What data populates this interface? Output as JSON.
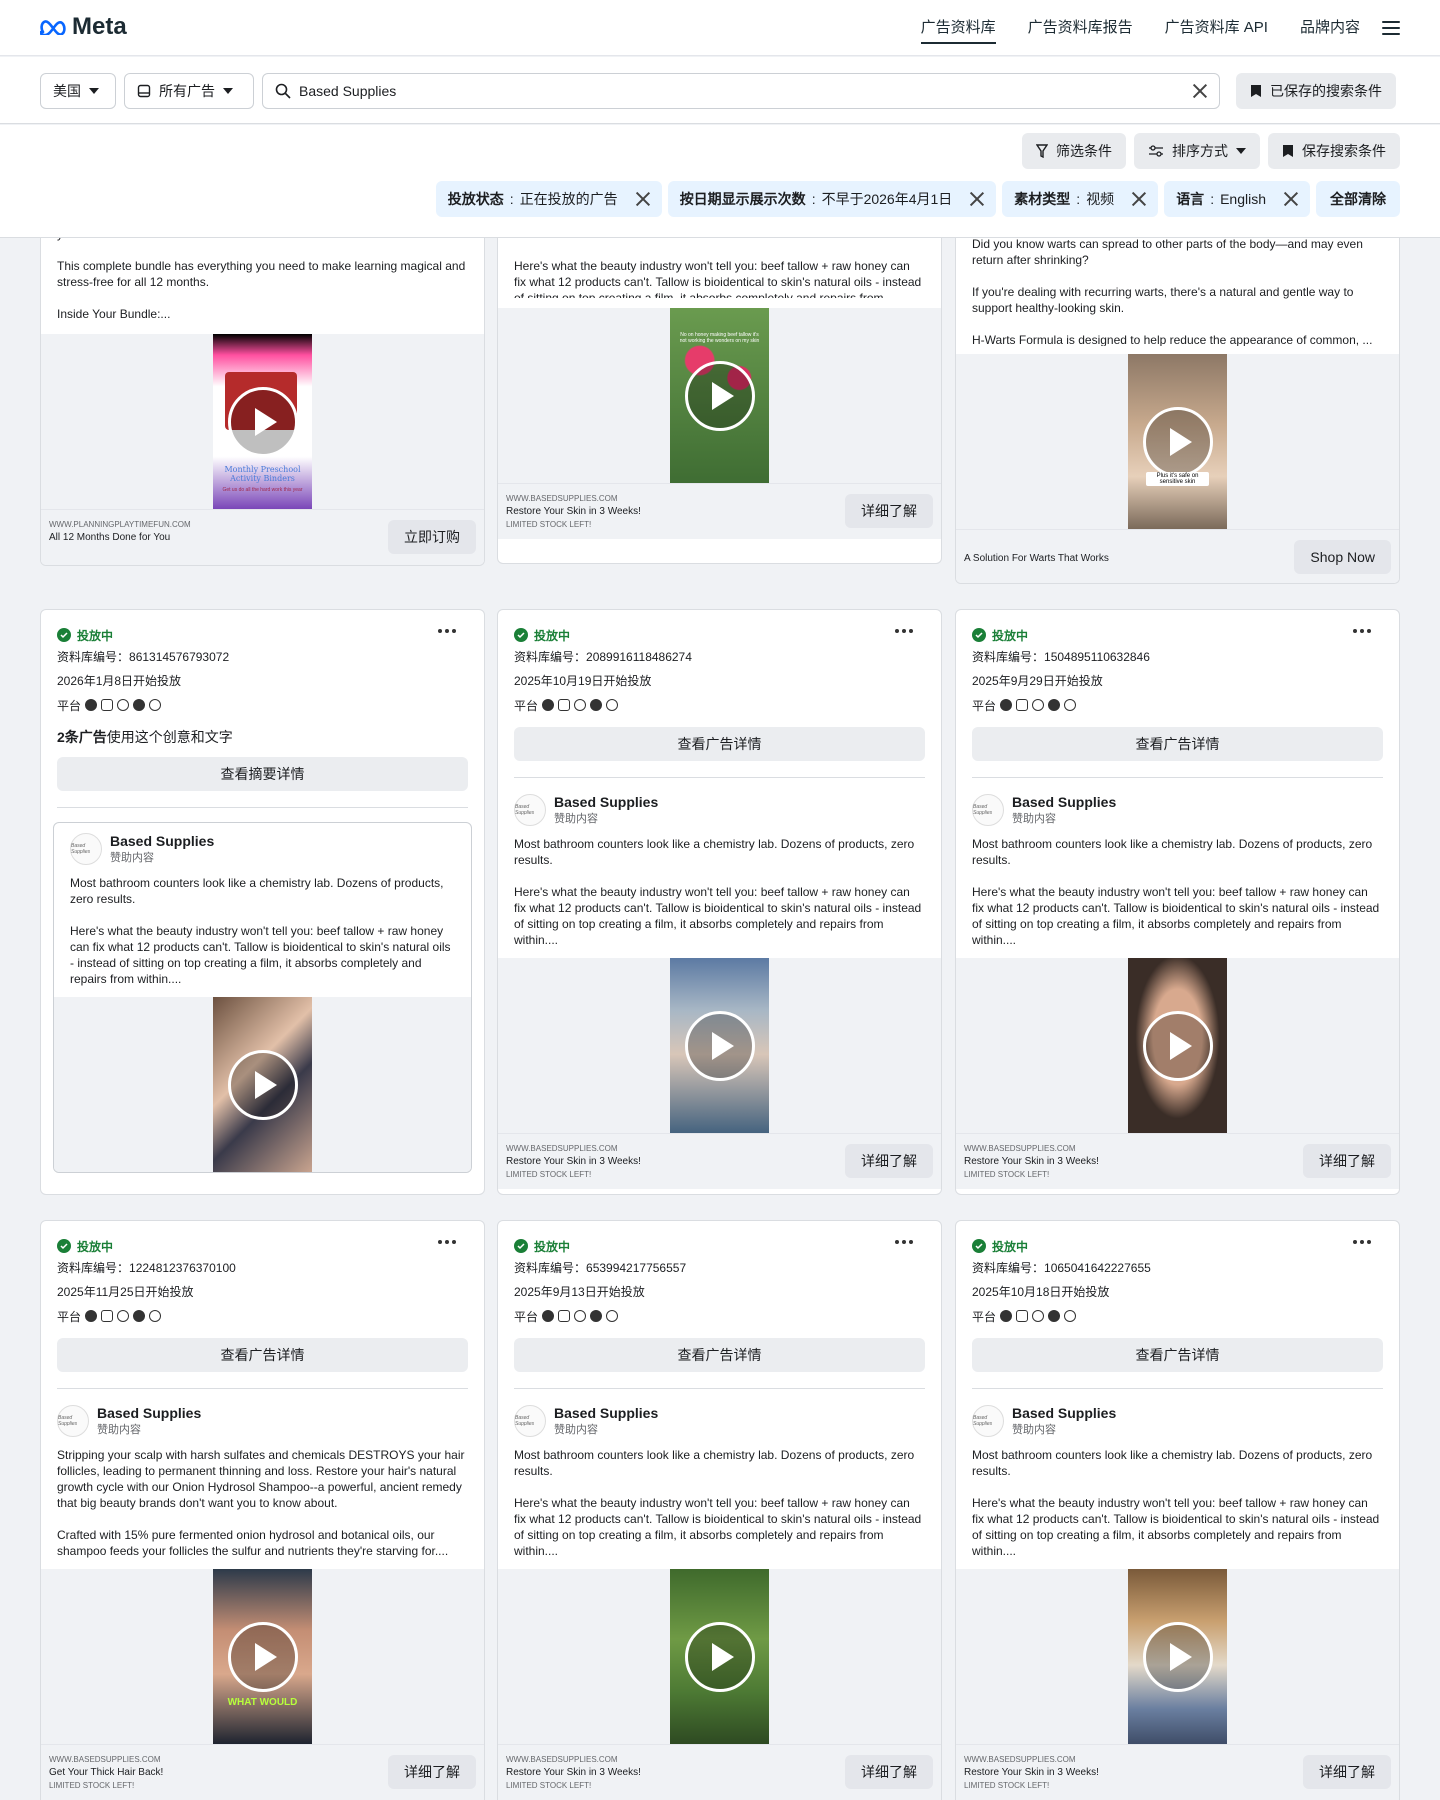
{
  "nav": {
    "logo": "Meta",
    "links": [
      "广告资料库",
      "广告资料库报告",
      "广告资料库 API",
      "品牌内容"
    ]
  },
  "search": {
    "country": "美国",
    "ad_type": "所有广告",
    "query": "Based Supplies",
    "saved_label": "已保存的搜索条件"
  },
  "tools": {
    "filter": "筛选条件",
    "sort": "排序方式",
    "save": "保存搜索条件"
  },
  "chips": [
    {
      "key": "投放状态",
      "value": "正在投放的广告"
    },
    {
      "key": "按日期显示展示次数",
      "value": "不早于2026年4月1日"
    },
    {
      "key": "素材类型",
      "value": "视频"
    },
    {
      "key": "语言",
      "value": "English"
    }
  ],
  "clear_all": "全部清除",
  "labels": {
    "status": "投放中",
    "lib": "资料库编号：",
    "platform": "平台",
    "details": "查看广告详情",
    "summary_details": "查看摘要详情",
    "sponsored": "赞助内容",
    "avatar": "Based Supplies",
    "summary_count": "2条广告",
    "summary_rest": "使用这个创意和文字"
  },
  "top_cards": [
    {
      "text": "year.\n\nThis complete bundle has everything you need to make learning magical and stress-free for all 12 months.\n\nInside Your Bundle:...",
      "site": "WWW.PLANNINGPLAYTIMEFUN.COM",
      "title": "All 12 Months Done for You",
      "desc": "",
      "cta": "立即订购",
      "overlay": "Monthly Preschool Activity Binders",
      "overlay2": "Get us do all the hard work this year"
    },
    {
      "text": "results.\n\nHere's what the beauty industry won't tell you: beef tallow + raw honey can fix what 12 products can't. Tallow is bioidentical to skin's natural oils - instead of sitting on top creating a film, it absorbs completely and repairs from within....",
      "site": "WWW.BASEDSUPPLIES.COM",
      "title": "Restore Your Skin in 3 Weeks!",
      "desc": "LIMITED STOCK LEFT!",
      "cta": "详细了解",
      "overlay": "No on honey making beef tallow it's not working the wonders on my skin",
      "overlay2": ""
    },
    {
      "text": "Did you know warts can spread to other parts of the body—and may even return after shrinking?\n\nIf you're dealing with recurring warts, there's a natural and gentle way to support healthy-looking skin.\n\nH-Warts Formula is designed to help reduce the appearance of common, ...",
      "site": "",
      "title": "A Solution For Warts That Works",
      "desc": "",
      "cta": "Shop Now",
      "overlay": "Plus it's safe on sensitive skin",
      "overlay2": ""
    }
  ],
  "cards": [
    {
      "id": "861314576793072",
      "date": "2026年1月8日开始投放",
      "advertiser": "Based Supplies",
      "text": "Most bathroom counters look like a chemistry lab. Dozens of products, zero results.\n\nHere's what the beauty industry won't tell you: beef tallow + raw honey can fix what 12 products can't. Tallow is bioidentical to skin's natural oils - instead of sitting on top creating a film, it absorbs completely and repairs from within....",
      "site": "",
      "title": "",
      "desc": "",
      "cta": "",
      "overlay": ""
    },
    {
      "id": "2089916118486274",
      "date": "2025年10月19日开始投放",
      "advertiser": "Based Supplies",
      "text": "Most bathroom counters look like a chemistry lab. Dozens of products, zero results.\n\nHere's what the beauty industry won't tell you: beef tallow + raw honey can fix what 12 products can't. Tallow is bioidentical to skin's natural oils - instead of sitting on top creating a film, it absorbs completely and repairs from within....",
      "site": "WWW.BASEDSUPPLIES.COM",
      "title": "Restore Your Skin in 3 Weeks!",
      "desc": "LIMITED STOCK LEFT!",
      "cta": "详细了解",
      "overlay": ""
    },
    {
      "id": "1504895110632846",
      "date": "2025年9月29日开始投放",
      "advertiser": "Based Supplies",
      "text": "Most bathroom counters look like a chemistry lab. Dozens of products, zero results.\n\nHere's what the beauty industry won't tell you: beef tallow + raw honey can fix what 12 products can't. Tallow is bioidentical to skin's natural oils - instead of sitting on top creating a film, it absorbs completely and repairs from within....",
      "site": "WWW.BASEDSUPPLIES.COM",
      "title": "Restore Your Skin in 3 Weeks!",
      "desc": "LIMITED STOCK LEFT!",
      "cta": "详细了解",
      "overlay": ""
    },
    {
      "id": "1224812376370100",
      "date": "2025年11月25日开始投放",
      "advertiser": "Based Supplies",
      "text": "Stripping your scalp with harsh sulfates and chemicals DESTROYS your hair follicles, leading to permanent thinning and loss. Restore your hair's natural growth cycle with our Onion Hydrosol Shampoo--a powerful, ancient remedy that big beauty brands don't want you to know about.\n\nCrafted with 15% pure fermented onion hydrosol and botanical oils, our shampoo feeds your follicles the sulfur and nutrients they're starving for....",
      "site": "WWW.BASEDSUPPLIES.COM",
      "title": "Get Your Thick Hair Back!",
      "desc": "LIMITED STOCK LEFT!",
      "cta": "详细了解",
      "overlay": "WHAT WOULD"
    },
    {
      "id": "653994217756557",
      "date": "2025年9月13日开始投放",
      "advertiser": "Based Supplies",
      "text": "Most bathroom counters look like a chemistry lab. Dozens of products, zero results.\n\nHere's what the beauty industry won't tell you: beef tallow + raw honey can fix what 12 products can't. Tallow is bioidentical to skin's natural oils - instead of sitting on top creating a film, it absorbs completely and repairs from within....",
      "site": "WWW.BASEDSUPPLIES.COM",
      "title": "Restore Your Skin in 3 Weeks!",
      "desc": "LIMITED STOCK LEFT!",
      "cta": "详细了解",
      "overlay": ""
    },
    {
      "id": "1065041642227655",
      "date": "2025年10月18日开始投放",
      "advertiser": "Based Supplies",
      "text": "Most bathroom counters look like a chemistry lab. Dozens of products, zero results.\n\nHere's what the beauty industry won't tell you: beef tallow + raw honey can fix what 12 products can't. Tallow is bioidentical to skin's natural oils - instead of sitting on top creating a film, it absorbs completely and repairs from within....",
      "site": "WWW.BASEDSUPPLIES.COM",
      "title": "Restore Your Skin in 3 Weeks!",
      "desc": "LIMITED STOCK LEFT!",
      "cta": "详细了解",
      "overlay": ""
    }
  ]
}
